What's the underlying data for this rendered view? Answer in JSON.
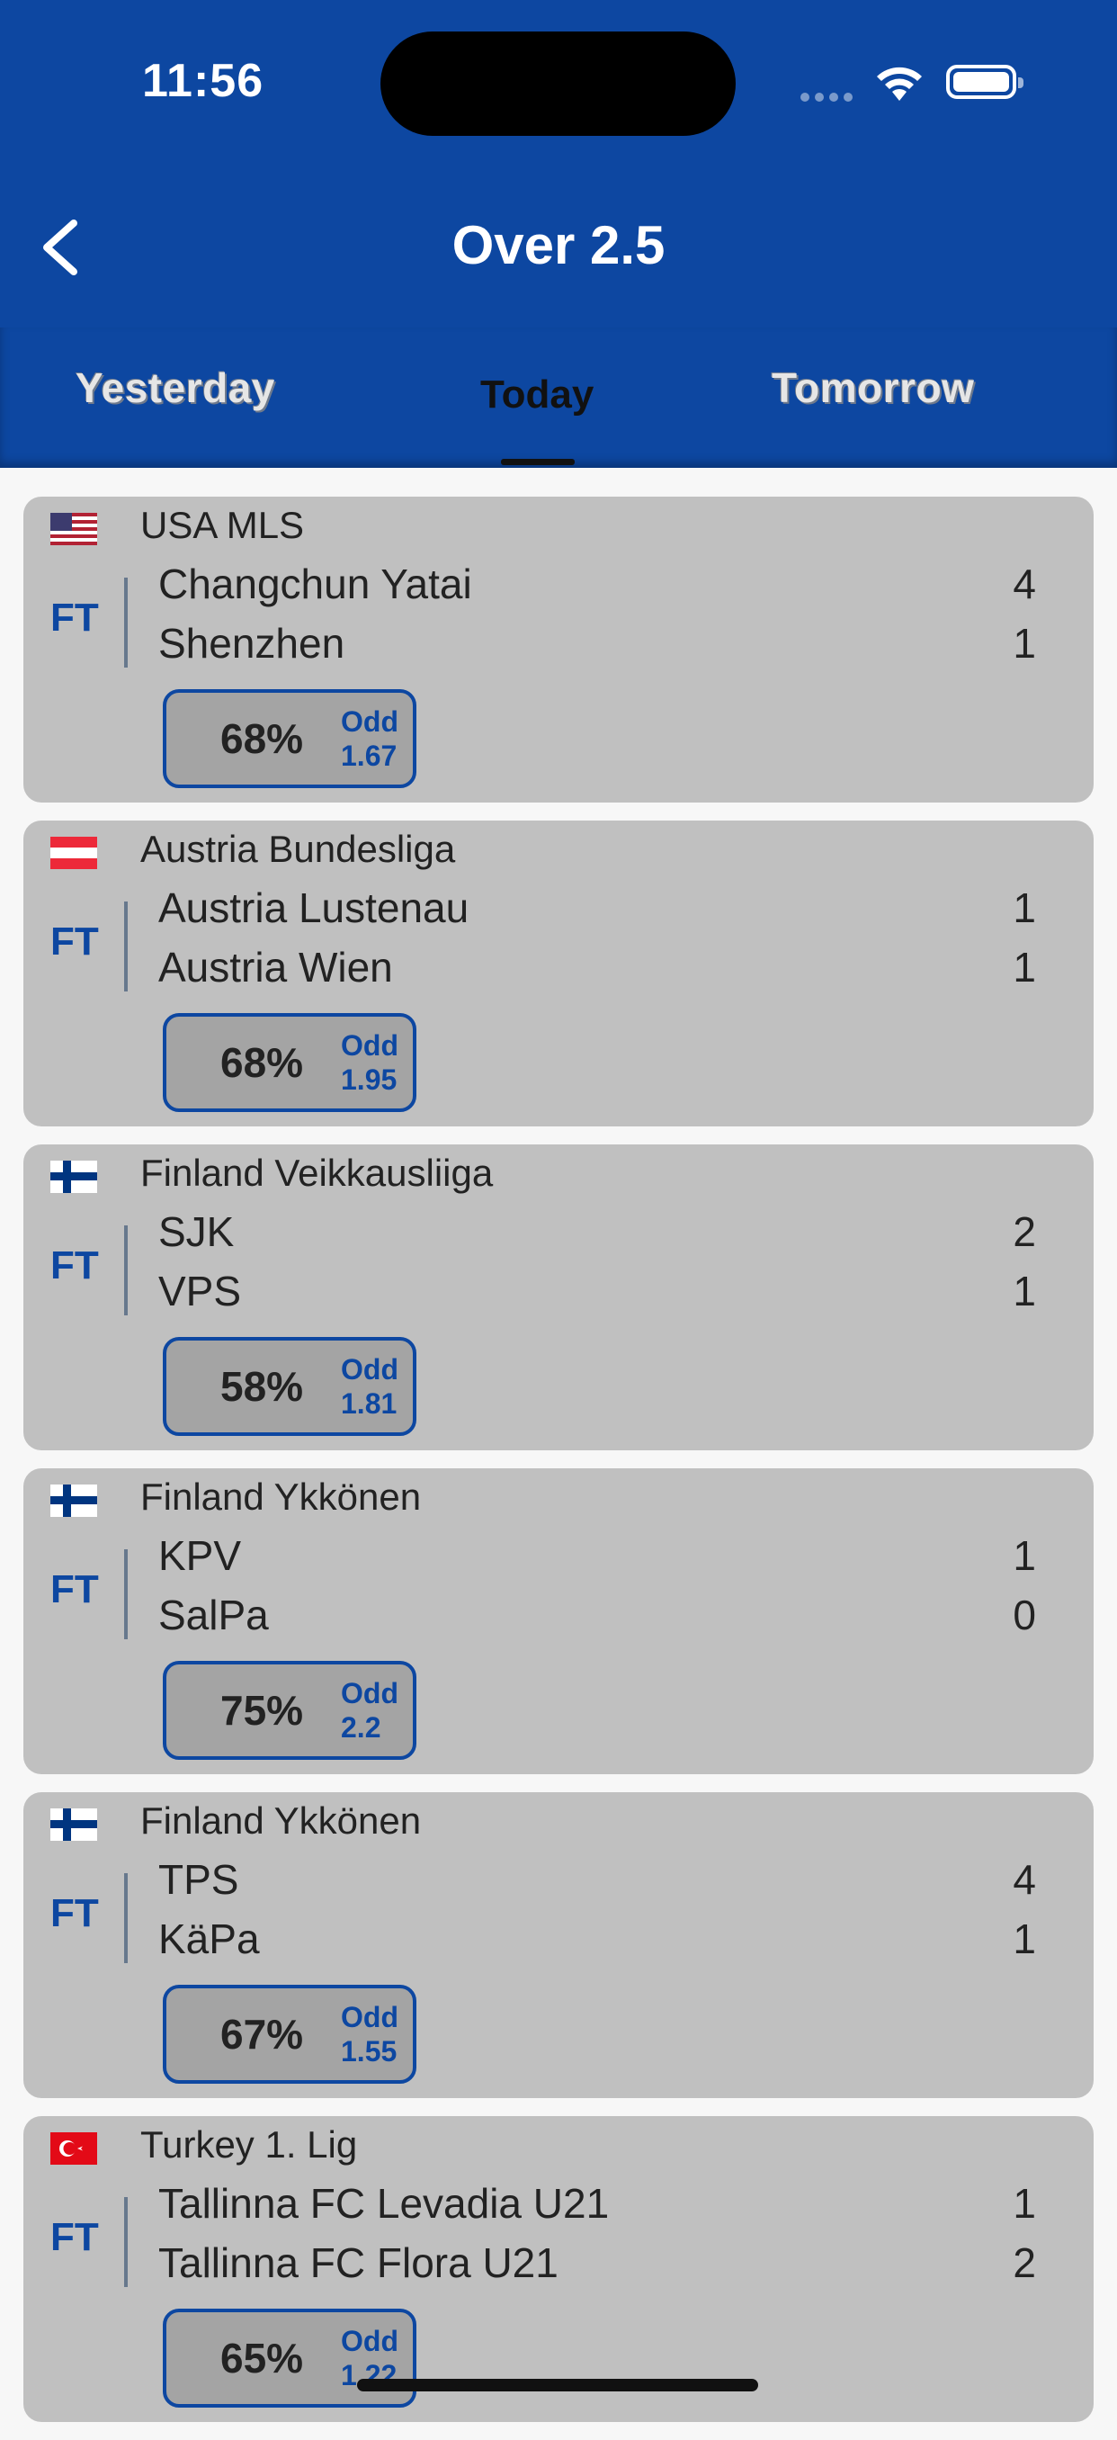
{
  "status_bar": {
    "time": "11:56"
  },
  "header": {
    "title": "Over 2.5",
    "back_icon": "chevron-left-icon"
  },
  "tabs": [
    {
      "label": "Yesterday",
      "active": false
    },
    {
      "label": "Today",
      "active": true
    },
    {
      "label": "Tomorrow",
      "active": false
    }
  ],
  "matches": [
    {
      "flag": "usa-flag",
      "league": "USA MLS",
      "status": "FT",
      "home": "Changchun Yatai",
      "away": "Shenzhen",
      "home_score": "4",
      "away_score": "1",
      "percent": "68%",
      "odd_label": "Odd",
      "odd": "1.67"
    },
    {
      "flag": "austria-flag",
      "league": "Austria Bundesliga",
      "status": "FT",
      "home": "Austria Lustenau",
      "away": "Austria Wien",
      "home_score": "1",
      "away_score": "1",
      "percent": "68%",
      "odd_label": "Odd",
      "odd": "1.95"
    },
    {
      "flag": "finland-flag",
      "league": "Finland Veikkausliiga",
      "status": "FT",
      "home": "SJK",
      "away": "VPS",
      "home_score": "2",
      "away_score": "1",
      "percent": "58%",
      "odd_label": "Odd",
      "odd": "1.81"
    },
    {
      "flag": "finland-flag",
      "league": "Finland Ykkönen",
      "status": "FT",
      "home": "KPV",
      "away": "SalPa",
      "home_score": "1",
      "away_score": "0",
      "percent": "75%",
      "odd_label": "Odd",
      "odd": "2.2"
    },
    {
      "flag": "finland-flag",
      "league": "Finland Ykkönen",
      "status": "FT",
      "home": "TPS",
      "away": "KäPa",
      "home_score": "4",
      "away_score": "1",
      "percent": "67%",
      "odd_label": "Odd",
      "odd": "1.55"
    },
    {
      "flag": "turkey-flag",
      "league": "Turkey 1. Lig",
      "status": "FT",
      "home": "Tallinna FC Levadia U21",
      "away": "Tallinna FC Flora U21",
      "home_score": "1",
      "away_score": "2",
      "percent": "65%",
      "odd_label": "Odd",
      "odd": "1.22"
    }
  ],
  "colors": {
    "primary": "#0d47a1",
    "card": "#c0c0c0",
    "pred_bg": "#a4a4a4"
  }
}
